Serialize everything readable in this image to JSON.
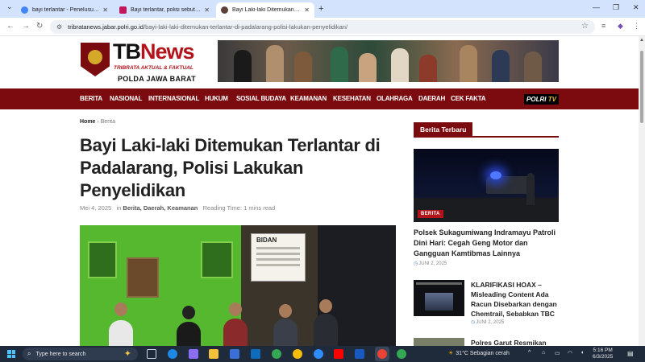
{
  "browser": {
    "tabs": [
      {
        "title": "bayi terlantar - Penelusuran Go",
        "favicon_color": "#4285f4"
      },
      {
        "title": "Bayi terlantar, polisi sebut pem",
        "favicon_color": "#c2185b"
      },
      {
        "title": "Bayi Laki-laki Ditemukan Terlant",
        "favicon_color": "#5d4037"
      }
    ],
    "new_tab": "+",
    "url_domain": "tribratanews.jabar.polri.go.id",
    "url_path": "/bayi-laki-laki-ditemukan-terlantar-di-padalarang-polisi-lakukan-penyelidikan/"
  },
  "site": {
    "logo_tb": "TB",
    "logo_news": "News",
    "tagline": "TRIBRATA AKTUAL & FAKTUAL",
    "org": "POLDA JAWA BARAT",
    "polri_tv_a": "POLRI",
    "polri_tv_b": "TV"
  },
  "nav": [
    "BERITA",
    "NASIONAL",
    "INTERNASIONAL",
    "HUKUM",
    "SOSIAL BUDAYA",
    "KEAMANAN",
    "KESEHATAN",
    "OLAHRAGA",
    "DAERAH",
    "CEK FAKTA"
  ],
  "article": {
    "breadcrumb_home": "Home",
    "breadcrumb_sep": "›",
    "breadcrumb_section": "Berita",
    "title": "Bayi Laki-laki Ditemukan Terlantar di Padalarang, Polisi Lakukan Penyelidikan",
    "date": "Mei 4, 2025",
    "in_label": "in",
    "categories": "Berita, Daerah, Keamanan",
    "reading_time": "Reading Time: 1 mins read",
    "photo_sign": "BIDAN"
  },
  "sidebar": {
    "heading": "Berita Terbaru",
    "featured": {
      "badge": "BERITA",
      "title": "Polsek Sukagumiwang Indramayu Patroli Dini Hari: Cegah Geng Motor dan Gangguan Kamtibmas Lainnya",
      "date": "JUNI 2, 2025"
    },
    "items": [
      {
        "title": "KLARIFIKASI HOAX – Misleading Content Ada Racun Disebarkan dengan Chemtrail, Sebabkan TBC",
        "date": "JUNI 2, 2025"
      },
      {
        "title": "Polres Garut Resmikan",
        "date": ""
      }
    ]
  },
  "taskbar": {
    "search_placeholder": "Type here to search",
    "weather": "31°C  Sebagian cerah",
    "time": "5:16 PM",
    "date": "6/3/2025"
  }
}
